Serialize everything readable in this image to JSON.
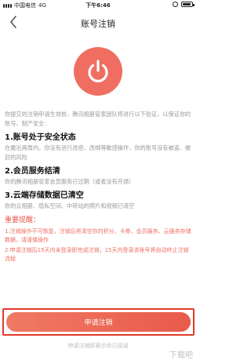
{
  "status_bar": {
    "carrier": "中国电信",
    "network": "4G",
    "time": "下午6:46",
    "battery_level": 0.9
  },
  "nav": {
    "title": "账号注销"
  },
  "content": {
    "intro": "你提交的注销申请生效前，腾讯相册管家团队将进行以下验证，以保证你的账号、财产安全：",
    "sections": [
      {
        "title": "1.账号处于安全状态",
        "text": "在最近两周内，你没有进行改密、改绑等敏感操作，你的账号没有被盗、被封的风险"
      },
      {
        "title": "2.会员服务结清",
        "text": "你的腾讯相册管家会员服务已过期（或者没有开通）"
      },
      {
        "title": "3.云端存储数据已清空",
        "text": "你的云相册、隐私空间、中转站的照片和视频已清空"
      }
    ],
    "warning_title": "重要提醒：",
    "warnings": [
      "1.注销操作不可恢复，注销后将清空你的积分、卡券、会员服务、云服务存储数据，请谨慎操作",
      "2.申请注销后15天内未登录即完成注销，15天内登录该账号将自动终止注销流程"
    ]
  },
  "actions": {
    "apply_label": "申请注销"
  },
  "footer": {
    "agree_text": "申请注销即表示你已阅读",
    "watermark": "下载吧"
  },
  "colors": {
    "accent": "#ef6e61",
    "highlight_border": "#e13a2a"
  }
}
